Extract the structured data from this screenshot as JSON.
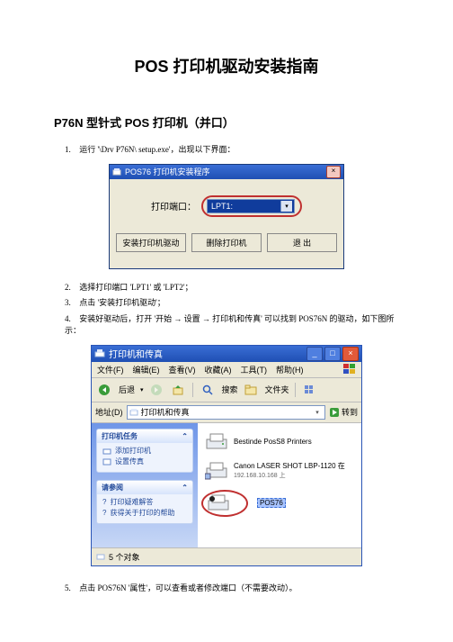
{
  "doc": {
    "title": "POS 打印机驱动安装指南",
    "subtitle": "P76N 型针式 POS 打印机（并口）"
  },
  "steps": {
    "s1": "运行 '\\Drv P76N\\ setup.exe'，出现以下界面：",
    "s2": "选择打印端口 'LPT1' 或 'LPT2'；",
    "s3": "点击 '安装打印机驱动'；",
    "s4": "安装好驱动后，打开 '开始 → 设置 → 打印机和传真' 可以找到 POS76N 的驱动，如下图所示：",
    "s5": "点击 POS76N '属性'，可以查看或者修改端口（不需要改动）。",
    "n1": "1.",
    "n2": "2.",
    "n3": "3.",
    "n4": "4.",
    "n5": "5."
  },
  "installer": {
    "title": "POS76 打印机安装程序",
    "port_label": "打印端口：",
    "port_value": "LPT1:",
    "btn_install": "安装打印机驱动",
    "btn_remove": "删除打印机",
    "btn_exit": "退  出"
  },
  "printers_window": {
    "title": "打印机和传真",
    "menu": {
      "file": "文件(F)",
      "edit": "编辑(E)",
      "view": "查看(V)",
      "fav": "收藏(A)",
      "tools": "工具(T)",
      "help": "帮助(H)"
    },
    "toolbar": {
      "back": "后退",
      "search": "搜索",
      "folders": "文件夹"
    },
    "address": {
      "label": "地址(D)",
      "value": "打印机和传真",
      "go": "转到"
    },
    "tasks_panel": {
      "title": "打印机任务",
      "add_printer": "添加打印机",
      "set_fax": "设置传真"
    },
    "see_also_panel": {
      "title": "请参阅",
      "item1": "打印疑难解答",
      "item2": "获得关于打印的帮助"
    },
    "printers": {
      "p1": {
        "name": "Bestinde PosS8 Printers"
      },
      "p2": {
        "name": "Canon LASER SHOT LBP-1120 在",
        "sub": "192.168.10.168 上"
      },
      "p3": {
        "name": "POS76"
      }
    },
    "status": "5 个对象"
  }
}
